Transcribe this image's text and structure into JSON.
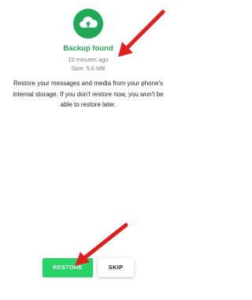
{
  "backup": {
    "icon": "cloud-upload-icon",
    "title": "Backup found",
    "time": "10 minutes ago",
    "size": "Size: 5.6 MB",
    "message": "Restore your messages and media from your phone's internal storage. If you don't restore now, you won't be able to restore later."
  },
  "buttons": {
    "restore": "RESTORE",
    "skip": "SKIP"
  },
  "colors": {
    "accent": "#1fa855",
    "button": "#25d366",
    "arrow": "#e0201c"
  }
}
